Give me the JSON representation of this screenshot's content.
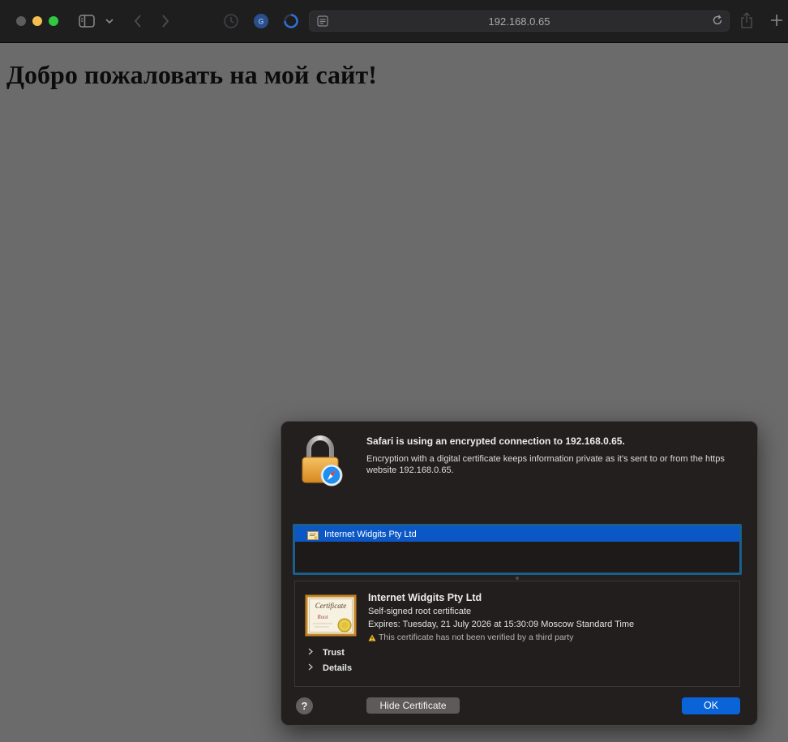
{
  "browser": {
    "address": "192.168.0.65",
    "icons": {
      "sidebar": "sidebar-icon",
      "chevron": "chevron-down-icon",
      "back": "chevron-left-icon",
      "forward": "chevron-right-icon",
      "extension1": "clock-icon",
      "extension2": "translate-icon",
      "extension3": "loading-spinner-icon",
      "reader": "reader-icon",
      "reload": "reload-icon",
      "share": "share-icon",
      "new_tab": "plus-icon"
    }
  },
  "page": {
    "heading": "Добро пожаловать на мой сайт!"
  },
  "dialog": {
    "title": "Safari is using an encrypted connection to 192.168.0.65.",
    "description": "Encryption with a digital certificate keeps information private as it’s sent to or from the https website 192.168.0.65.",
    "certificate_list": [
      {
        "label": "Internet Widgits Pty Ltd",
        "selected": true
      }
    ],
    "detail": {
      "name": "Internet Widgits Pty Ltd",
      "type": "Self-signed root certificate",
      "expires": "Expires: Tuesday, 21 July 2026 at 15:30:09 Moscow Standard Time",
      "warning": "This certificate has not been verified by a third party",
      "trust_label": "Trust",
      "details_label": "Details"
    },
    "buttons": {
      "help": "?",
      "hide_certificate": "Hide Certificate",
      "ok": "OK"
    }
  },
  "colors": {
    "page_bg": "#6b6b6b",
    "toolbar_bg": "#1f1e1f",
    "dialog_bg": "#231f1f",
    "selection": "#0b57c5",
    "ok_button": "#0b63d8",
    "focus_ring": "#1a5f8e",
    "traffic_min": "#f4bf4f",
    "traffic_max": "#2fc840"
  }
}
